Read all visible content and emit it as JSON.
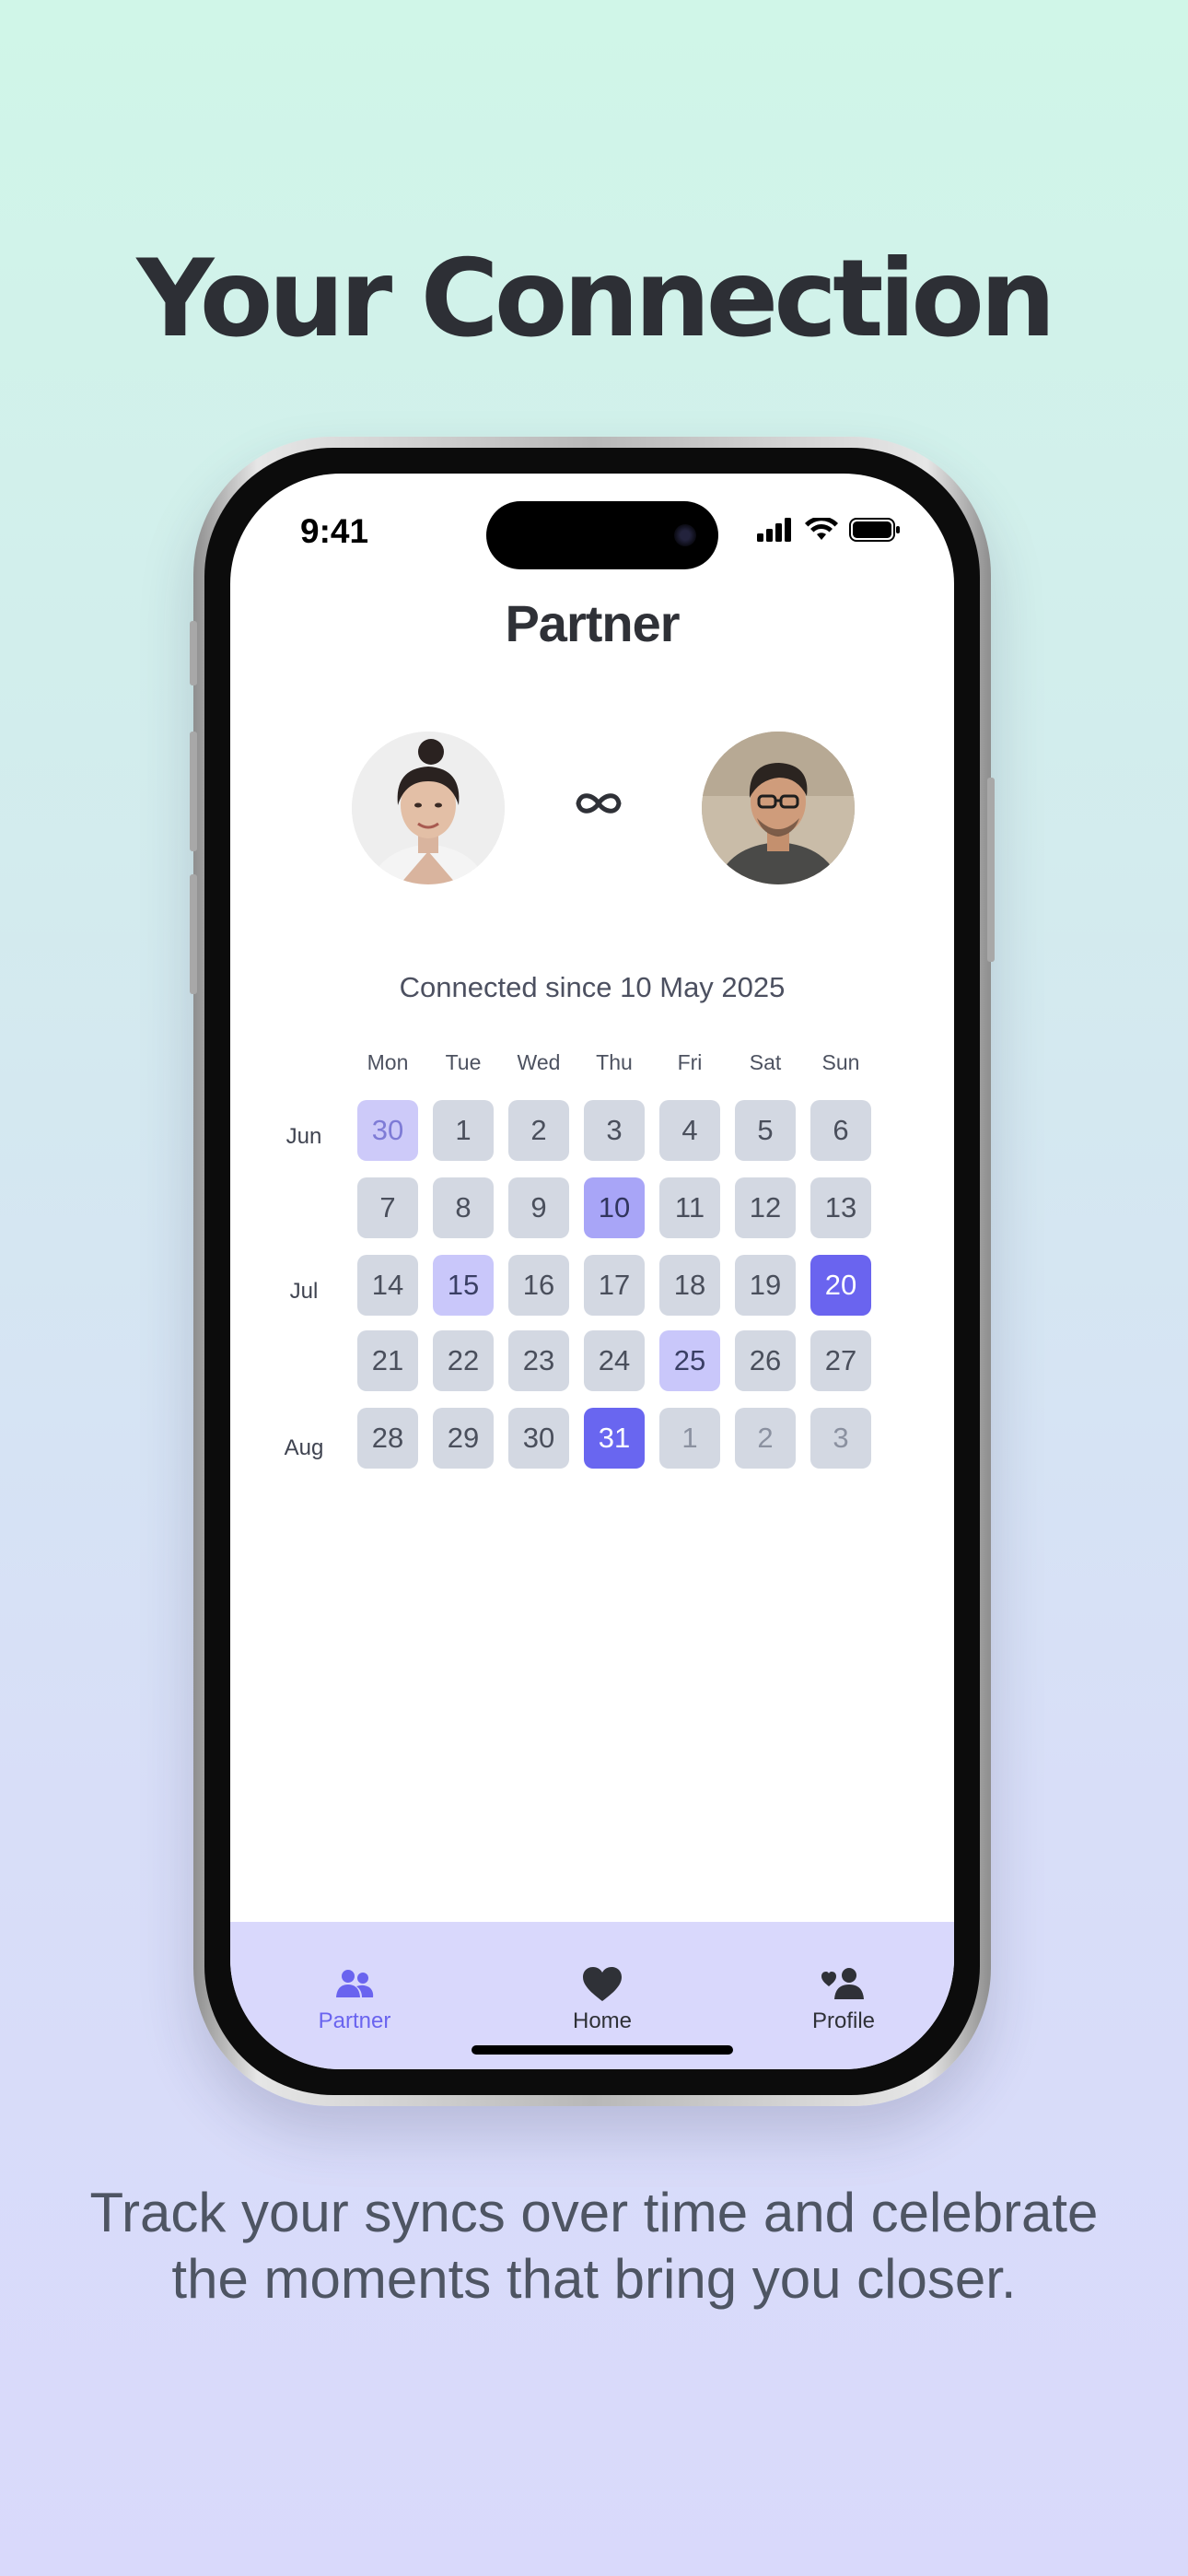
{
  "headline": "Your Connection",
  "caption_line1": "Track your syncs over time and celebrate",
  "caption_line2": "the moments that bring you closer.",
  "status": {
    "time": "9:41"
  },
  "screen": {
    "title": "Partner",
    "connected_text": "Connected since 10 May 2025"
  },
  "calendar": {
    "day_headers": [
      "Mon",
      "Tue",
      "Wed",
      "Thu",
      "Fri",
      "Sat",
      "Sun"
    ],
    "month_labels": [
      "Jun",
      "Jul",
      "Aug"
    ],
    "rows": [
      [
        "30",
        "1",
        "2",
        "3",
        "4",
        "5",
        "6"
      ],
      [
        "7",
        "8",
        "9",
        "10",
        "11",
        "12",
        "13"
      ],
      [
        "14",
        "15",
        "16",
        "17",
        "18",
        "19",
        "20"
      ],
      [
        "21",
        "22",
        "23",
        "24",
        "25",
        "26",
        "27"
      ],
      [
        "28",
        "29",
        "30",
        "31",
        "1",
        "2",
        "3"
      ]
    ]
  },
  "tabs": {
    "partner": "Partner",
    "home": "Home",
    "profile": "Profile"
  },
  "colors": {
    "accent": "#6a64ef",
    "tab_active": "#6a64ef",
    "tabbar_bg": "#d9d8fc"
  }
}
